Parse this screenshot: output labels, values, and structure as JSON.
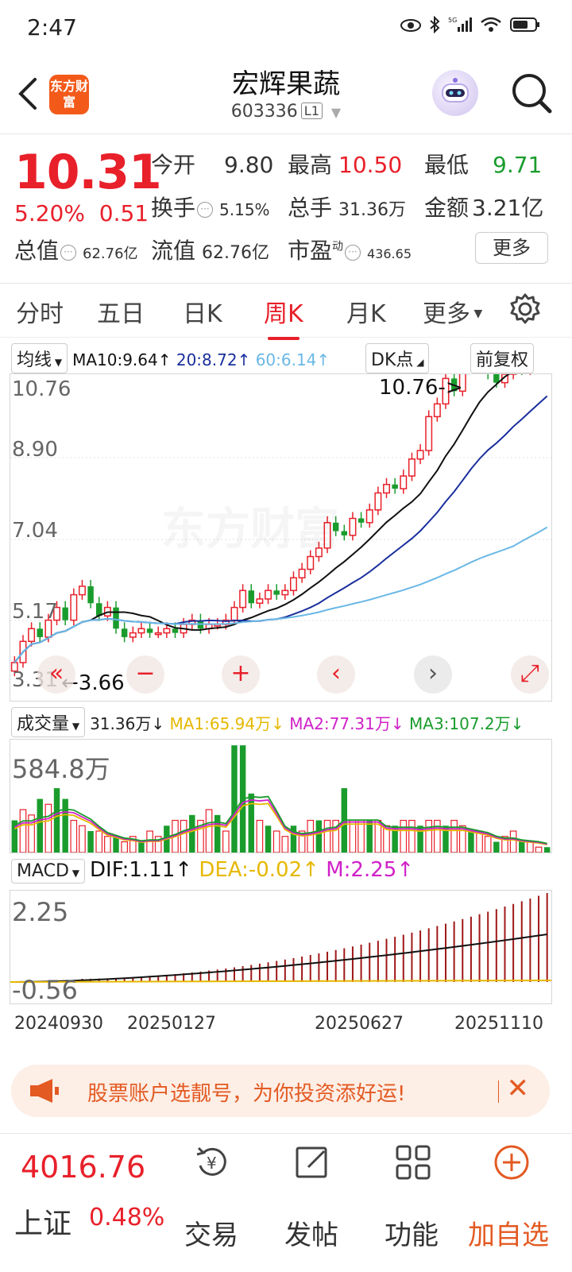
{
  "status": {
    "time": "2:47"
  },
  "header": {
    "logo_text": "东方财富",
    "title": "宏辉果蔬",
    "code": "603336",
    "badge": "L1"
  },
  "quote": {
    "price": "10.31",
    "change_pct": "5.20%",
    "change_abs": "0.51",
    "open_label": "今开",
    "open": "9.80",
    "high_label": "最高",
    "high": "10.50",
    "low_label": "最低",
    "low": "9.71",
    "turnover_label": "换手",
    "turnover": "5.15%",
    "volume_label": "总手",
    "volume": "31.36万",
    "amount_label": "金额",
    "amount": "3.21亿",
    "mktcap_label": "总值",
    "mktcap": "62.76亿",
    "float_label": "流值",
    "float": "62.76亿",
    "pe_label": "市盈",
    "pe_sup": "动",
    "pe": "436.65",
    "more": "更多"
  },
  "tabs": [
    {
      "label": "分时"
    },
    {
      "label": "五日"
    },
    {
      "label": "日K"
    },
    {
      "label": "周K"
    },
    {
      "label": "月K"
    },
    {
      "label": "更多"
    }
  ],
  "ma_legend": {
    "selector": "均线",
    "ma10": "MA10:9.64↑",
    "ma20": "20:8.72↑",
    "ma60": "60:6.14↑",
    "dk": "DK点",
    "adjust": "前复权"
  },
  "kline": {
    "y_labels": [
      "10.76",
      "8.90",
      "7.04",
      "5.17",
      "3.31"
    ],
    "max_annot": "10.76->",
    "min_annot": "3.66",
    "watermark": "东方财富"
  },
  "volume_legend": {
    "selector": "成交量",
    "vol": "31.36万↓",
    "ma1": "MA1:65.94万↓",
    "ma2": "MA2:77.31万↓",
    "ma3": "MA3:107.2万↓",
    "max_label": "584.8万"
  },
  "macd_legend": {
    "selector": "MACD",
    "dif": "DIF:1.11↑",
    "dea": "DEA:-0.02↑",
    "m": "M:2.25↑",
    "top_label": "2.25",
    "bottom_label": "-0.56"
  },
  "dates": [
    "20240930",
    "20250127",
    "20250627",
    "20251110"
  ],
  "banner": {
    "text": "股票账户选靓号，为你投资添好运!"
  },
  "bottom": {
    "index_value": "4016.76",
    "index_name": "上证",
    "index_pct": "0.48%",
    "trade": "交易",
    "post": "发帖",
    "func": "功能",
    "add": "加自选"
  },
  "colors": {
    "up": "#e8202a",
    "down": "#1a9c2d",
    "ma10": "#111111",
    "ma20": "#1a2f9c",
    "ma60": "#6ab8e6"
  }
}
